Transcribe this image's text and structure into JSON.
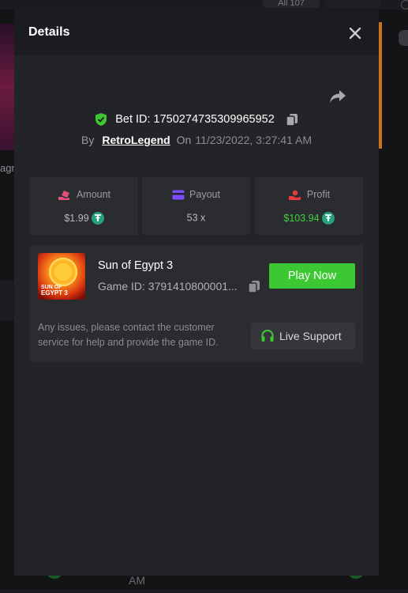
{
  "background": {
    "filter_label": "All 107",
    "left_text": "agn",
    "bottom_text": "AM"
  },
  "modal": {
    "title": "Details",
    "close_icon": "close-icon",
    "share_icon": "share-icon"
  },
  "bet": {
    "id_label": "Bet ID: 1750274735309965952",
    "by_label": "By",
    "user": "RetroLegend",
    "on_label": "On",
    "date": "11/23/2022, 3:27:41 AM"
  },
  "stats": {
    "amount": {
      "label": "Amount",
      "value": "$1.99",
      "icon": "money-hand-icon"
    },
    "payout": {
      "label": "Payout",
      "value": "53 x",
      "icon": "card-icon"
    },
    "profit": {
      "label": "Profit",
      "value": "$103.94",
      "icon": "profit-hand-icon"
    },
    "currency_icon": "tether-icon"
  },
  "game": {
    "name": "Sun of Egypt 3",
    "id_label": "Game ID: 3791410800001...",
    "thumb_text_line1": "SUN OF",
    "thumb_text_line2": "EGYPT 3",
    "play_label": "Play Now"
  },
  "support": {
    "text": "Any issues, please contact the customer service for help and provide the game ID.",
    "button_label": "Live Support",
    "icon": "headset-icon"
  },
  "colors": {
    "accent_green": "#3cc832",
    "profit_green": "#3fd43f",
    "tether": "#26a17b",
    "amount_icon": "#e0507a",
    "payout_icon": "#7b4dff",
    "profit_icon": "#e83b3b"
  }
}
